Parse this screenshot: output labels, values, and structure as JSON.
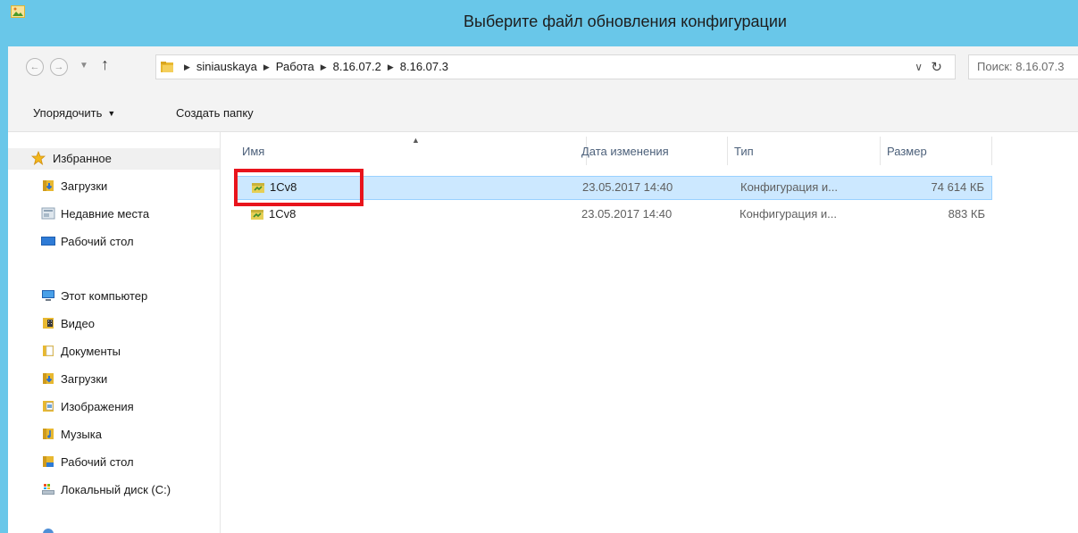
{
  "window": {
    "title": "Выберите файл обновления конфигурации"
  },
  "nav": {
    "back_icon": "back-arrow-icon",
    "forward_icon": "forward-arrow-icon",
    "up_icon": "up-arrow-icon",
    "breadcrumbs": [
      "siniauskaya",
      "Работа",
      "8.16.07.2",
      "8.16.07.3"
    ],
    "search_placeholder": "Поиск: 8.16.07.3"
  },
  "toolbar": {
    "organize_label": "Упорядочить",
    "new_folder_label": "Создать папку"
  },
  "navpane": {
    "favorites_label": "Избранное",
    "favorites": [
      "Загрузки",
      "Недавние места",
      "Рабочий стол"
    ],
    "computer_label": "Этот компьютер",
    "computer_items": [
      "Видео",
      "Документы",
      "Загрузки",
      "Изображения",
      "Музыка",
      "Рабочий стол",
      "Локальный диск (C:)"
    ]
  },
  "columns": {
    "name": "Имя",
    "date": "Дата изменения",
    "type": "Тип",
    "size": "Размер"
  },
  "files": [
    {
      "name": "1Cv8",
      "date": "23.05.2017 14:40",
      "type": "Конфигурация и...",
      "size": "74 614 КБ",
      "selected": true
    },
    {
      "name": "1Cv8",
      "date": "23.05.2017 14:40",
      "type": "Конфигурация и...",
      "size": "883 КБ",
      "selected": false
    }
  ],
  "colors": {
    "titlebar": "#69c7e9",
    "selection": "#cce8ff",
    "annotation": "#e8141c"
  }
}
